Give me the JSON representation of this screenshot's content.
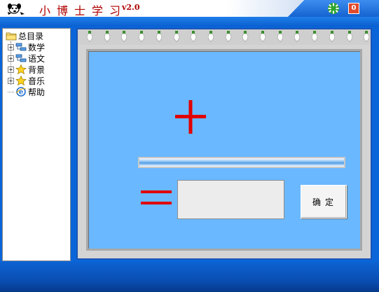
{
  "titlebar": {
    "title": "小博士学习",
    "version": "v2.0",
    "logo_icon": "cartoon-dog-logo-icon",
    "settings_icon": "green-gear-icon",
    "close_icon": "close-icon",
    "close_glyph": "0",
    "accent_color": "#b00000"
  },
  "tree": {
    "root": {
      "label": "总目录",
      "icon": "folder-icon"
    },
    "items": [
      {
        "label": "数学",
        "icon": "network-icon",
        "expander": "+"
      },
      {
        "label": "语文",
        "icon": "network-icon",
        "expander": "+"
      },
      {
        "label": "背景",
        "icon": "star-icon",
        "expander": "+"
      },
      {
        "label": "音乐",
        "icon": "star-icon",
        "expander": "+"
      },
      {
        "label": "帮助",
        "icon": "ie-browser-icon"
      }
    ]
  },
  "exercise": {
    "operator": "+",
    "operator_icon": "plus-sign-icon",
    "equals_icon": "equals-sign-icon",
    "answer_value": "",
    "confirm_label": "确定",
    "operator_color": "#e00000",
    "panel_color": "#6ab8ff"
  }
}
